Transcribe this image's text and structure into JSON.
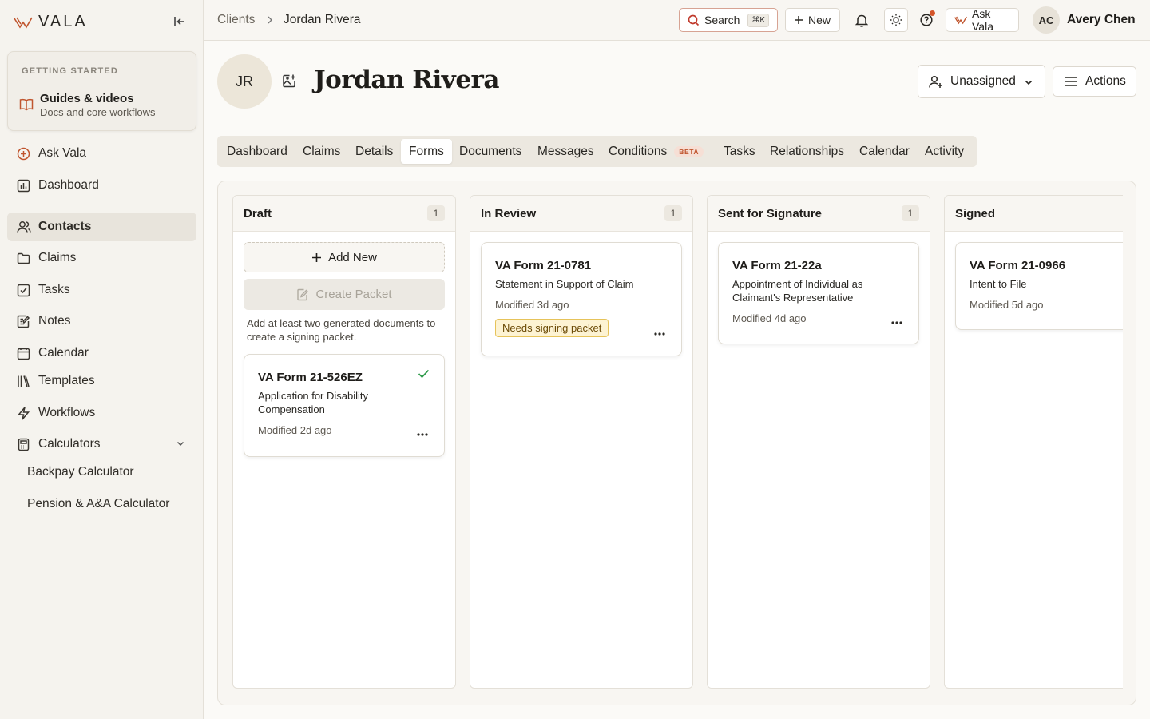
{
  "app": {
    "logo_text": "VALA"
  },
  "sidebar": {
    "getting_started": {
      "label": "GETTING STARTED",
      "title": "Guides & videos",
      "subtitle": "Docs and core workflows"
    },
    "items": [
      {
        "label": "Ask Vala",
        "icon": "plus-circle-icon"
      },
      {
        "label": "Dashboard",
        "icon": "chart-icon"
      },
      {
        "label": "Contacts",
        "icon": "users-icon",
        "active": true
      },
      {
        "label": "Claims",
        "icon": "folder-icon"
      },
      {
        "label": "Tasks",
        "icon": "checkbox-icon"
      },
      {
        "label": "Notes",
        "icon": "note-icon"
      },
      {
        "label": "Calendar",
        "icon": "calendar-icon"
      },
      {
        "label": "Templates",
        "icon": "library-icon"
      },
      {
        "label": "Workflows",
        "icon": "bolt-icon"
      },
      {
        "label": "Calculators",
        "icon": "calculator-icon",
        "expanded": true
      }
    ],
    "sub_items": [
      {
        "label": "Backpay Calculator"
      },
      {
        "label": "Pension & A&A Calculator"
      }
    ]
  },
  "topbar": {
    "breadcrumb": [
      "Clients",
      "Jordan Rivera"
    ],
    "search_label": "Search",
    "search_shortcut": "⌘K",
    "new_label": "New",
    "ask_vala_label": "Ask Vala",
    "user": {
      "initials": "AC",
      "name": "Avery Chen"
    }
  },
  "header": {
    "initials": "JR",
    "title": "Jordan Rivera",
    "assign_label": "Unassigned",
    "actions_label": "Actions"
  },
  "tabs": [
    {
      "label": "Dashboard"
    },
    {
      "label": "Claims"
    },
    {
      "label": "Details"
    },
    {
      "label": "Forms",
      "active": true
    },
    {
      "label": "Documents"
    },
    {
      "label": "Messages"
    },
    {
      "label": "Conditions",
      "badge": "BETA"
    },
    {
      "label": "Tasks"
    },
    {
      "label": "Relationships"
    },
    {
      "label": "Calendar"
    },
    {
      "label": "Activity"
    }
  ],
  "board": {
    "columns": [
      {
        "title": "Draft",
        "count": "1",
        "add_new_label": "Add New",
        "create_packet_label": "Create Packet",
        "hint": "Add at least two generated documents to create a signing packet.",
        "cards": [
          {
            "title": "VA Form 21-526EZ",
            "desc": "Application for Disability Compensation",
            "modified": "Modified 2d ago",
            "checked": true
          }
        ]
      },
      {
        "title": "In Review",
        "count": "1",
        "cards": [
          {
            "title": "VA Form 21-0781",
            "desc": "Statement in Support of Claim",
            "modified": "Modified 3d ago",
            "badge": "Needs signing packet"
          }
        ]
      },
      {
        "title": "Sent for Signature",
        "count": "1",
        "cards": [
          {
            "title": "VA Form 21-22a",
            "desc": "Appointment of Individual as Claimant's Representative",
            "modified": "Modified 4d ago"
          }
        ]
      },
      {
        "title": "Signed",
        "cards": [
          {
            "title": "VA Form 21-0966",
            "desc": "Intent to File",
            "modified": "Modified 5d ago"
          }
        ]
      }
    ]
  },
  "colors": {
    "accent": "#c0552e",
    "success": "#2e9a4a",
    "warning_bg": "#fdf3d3",
    "warning_border": "#e6c35a",
    "sidebar_bg": "#f5f3ee"
  }
}
